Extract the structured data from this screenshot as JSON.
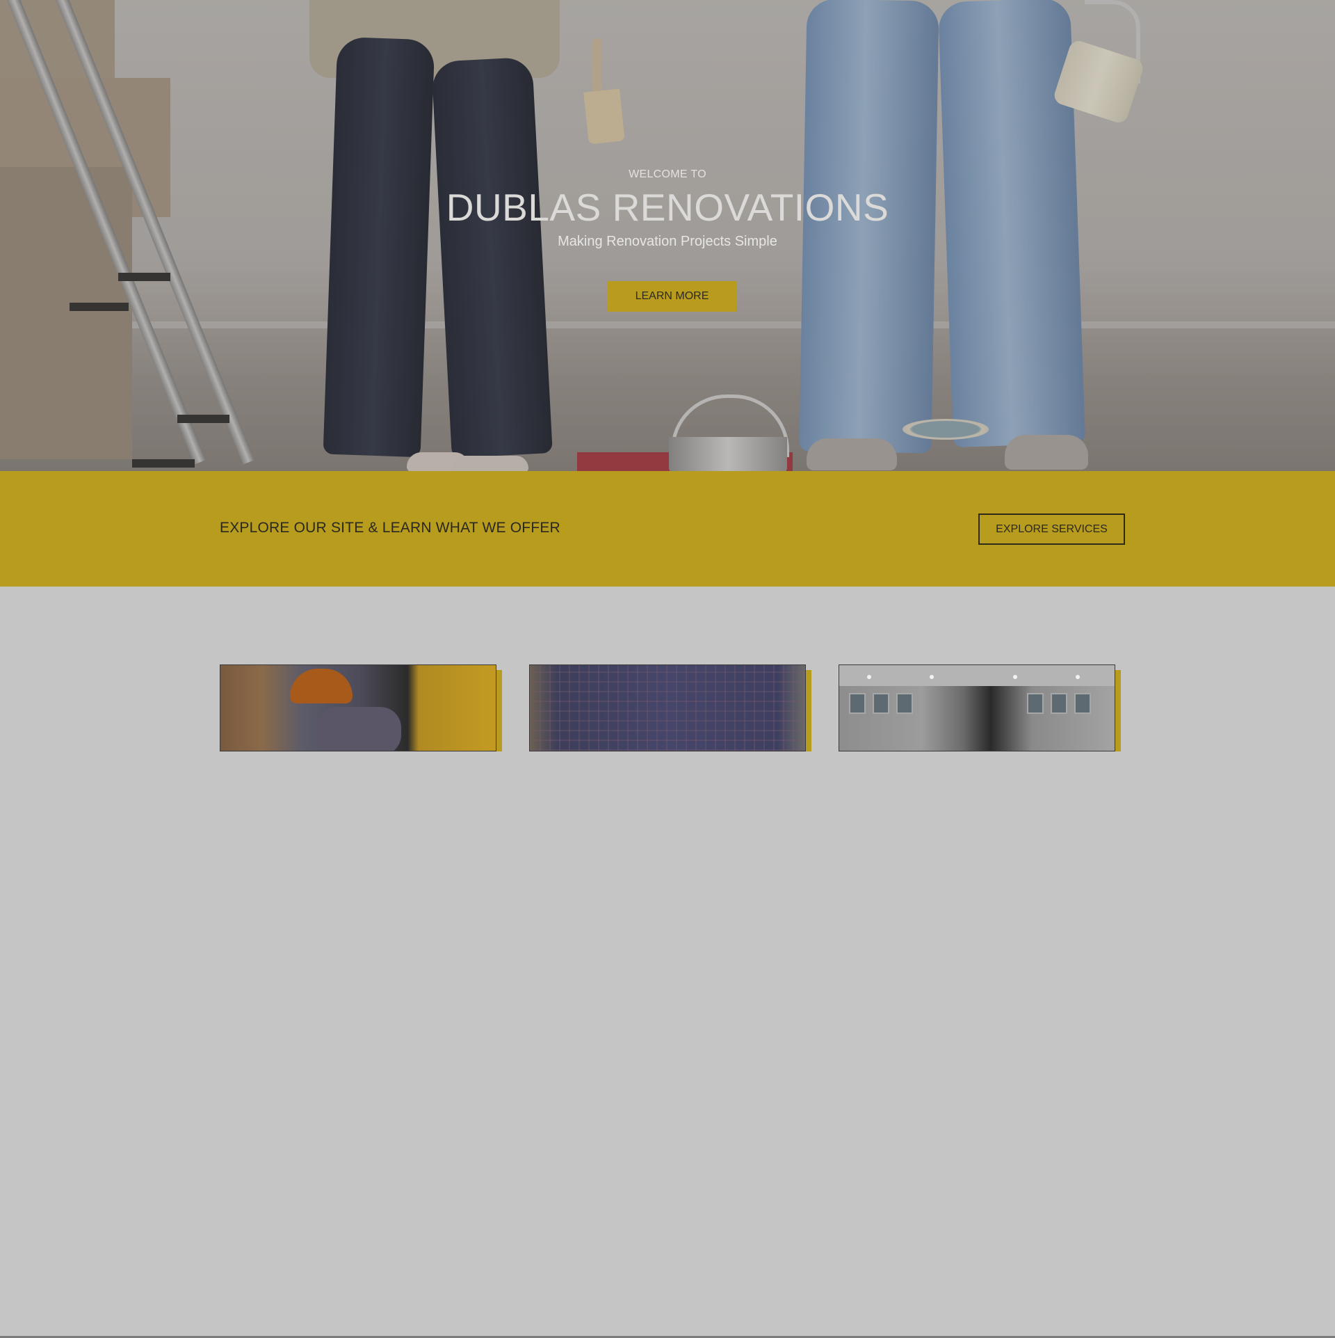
{
  "hero": {
    "eyebrow": "WELCOME TO",
    "title": "DUBLAS RENOVATIONS",
    "subtitle": "Making Renovation Projects Simple",
    "cta_label": "LEARN MORE"
  },
  "band": {
    "text": "EXPLORE OUR SITE & LEARN WHAT WE OFFER",
    "button_label": "EXPLORE SERVICES"
  },
  "colors": {
    "accent": "#b89c1e",
    "section_background": "#c5c5c5"
  },
  "services": {
    "cards": [
      {
        "image": "worker-photo"
      },
      {
        "image": "consultant-photo"
      },
      {
        "image": "kitchen-interior-photo"
      }
    ]
  }
}
